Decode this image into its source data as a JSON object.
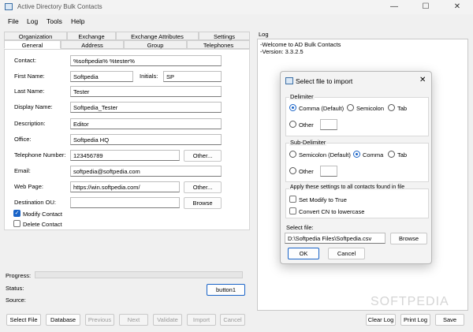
{
  "window": {
    "title": "Active Directory Bulk Contacts",
    "controls": {
      "minimize": "—",
      "maximize": "☐",
      "close": "✕"
    }
  },
  "menu": [
    "File",
    "Log",
    "Tools",
    "Help"
  ],
  "tabs_row1": [
    "Organization",
    "Exchange",
    "Exchange Attributes",
    "Settings"
  ],
  "tabs_row2": [
    "General",
    "Address",
    "Group",
    "Telephones"
  ],
  "form": {
    "contact": {
      "label": "Contact:",
      "value": "%softpedia% %tester%"
    },
    "first_name": {
      "label": "First Name:",
      "value": "Softpedia"
    },
    "initials": {
      "label": "Initials:",
      "value": "SP"
    },
    "last_name": {
      "label": "Last Name:",
      "value": "Tester"
    },
    "display_name": {
      "label": "Display Name:",
      "value": "Softpedia_Tester"
    },
    "description": {
      "label": "Description:",
      "value": "Editor"
    },
    "office": {
      "label": "Office:",
      "value": "Softpedia HQ"
    },
    "telephone": {
      "label": "Telephone Number:",
      "value": "123456789",
      "button": "Other..."
    },
    "email": {
      "label": "Email:",
      "value": "softpedia@softpedia.com"
    },
    "web_page": {
      "label": "Web Page:",
      "value": "https://win.softpedia.com/",
      "button": "Other..."
    },
    "destination_ou": {
      "label": "Destination OU:",
      "value": "",
      "button": "Browse"
    },
    "modify_contact": {
      "label": "Modify Contact",
      "checked": true
    },
    "delete_contact": {
      "label": "Delete Contact",
      "checked": false
    }
  },
  "status": {
    "progress_label": "Progress:",
    "progress": 0,
    "status_label": "Status:",
    "source_label": "Source:",
    "button1": "button1"
  },
  "bottom_buttons": {
    "select_file": "Select File",
    "database": "Database",
    "previous": "Previous",
    "next": "Next",
    "validate": "Validate",
    "import": "Import",
    "cancel": "Cancel"
  },
  "log": {
    "title": "Log",
    "lines": [
      "-Welcome to AD Bulk Contacts",
      "-Version: 3.3.2.5"
    ],
    "clear": "Clear Log",
    "print": "Print Log",
    "save": "Save"
  },
  "dialog": {
    "title": "Select file to import",
    "delimiter": {
      "title": "Delimiter",
      "comma": "Comma (Default)",
      "semicolon": "Semicolon",
      "tab": "Tab",
      "other": "Other",
      "selected": "comma"
    },
    "subdelimiter": {
      "title": "Sub-Delimiter",
      "semicolon": "Semicolon (Default)",
      "comma": "Comma",
      "tab": "Tab",
      "other": "Other",
      "selected": "comma"
    },
    "apply": {
      "title": "Apply these settings to all contacts found in file",
      "set_modify": "Set Modify to True",
      "convert_cn": "Convert CN to lowercase"
    },
    "select_file_label": "Select file:",
    "file_path": "D:\\Softpedia Files\\Softpedia.csv",
    "browse": "Browse",
    "ok": "OK",
    "cancel": "Cancel",
    "close": "✕"
  },
  "colors": {
    "accent": "#1a64c8"
  },
  "watermark": "SOFTPEDIA"
}
